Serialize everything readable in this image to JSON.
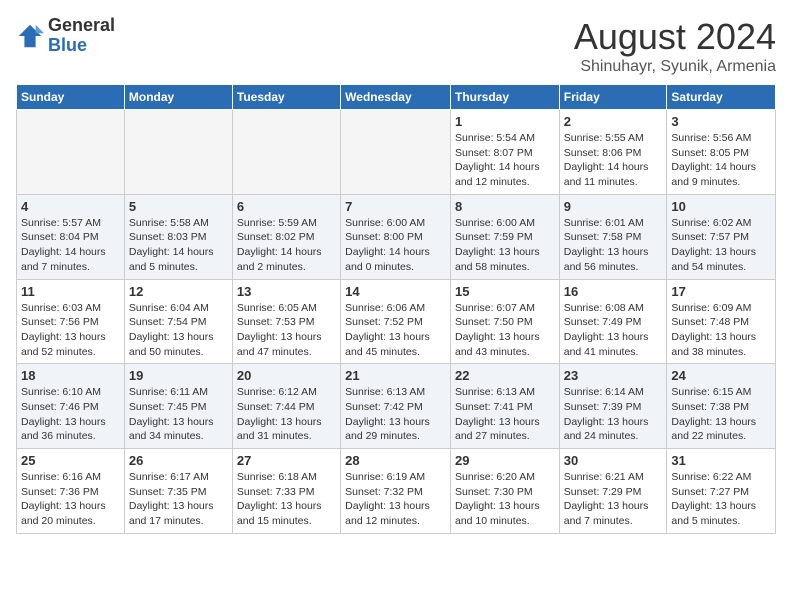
{
  "header": {
    "logo": {
      "general": "General",
      "blue": "Blue"
    },
    "title": "August 2024",
    "subtitle": "Shinuhayr, Syunik, Armenia"
  },
  "calendar": {
    "weekdays": [
      "Sunday",
      "Monday",
      "Tuesday",
      "Wednesday",
      "Thursday",
      "Friday",
      "Saturday"
    ],
    "weeks": [
      [
        {
          "day": "",
          "empty": true
        },
        {
          "day": "",
          "empty": true
        },
        {
          "day": "",
          "empty": true
        },
        {
          "day": "",
          "empty": true
        },
        {
          "day": "1",
          "sunrise": "5:54 AM",
          "sunset": "8:07 PM",
          "daylight": "14 hours and 12 minutes."
        },
        {
          "day": "2",
          "sunrise": "5:55 AM",
          "sunset": "8:06 PM",
          "daylight": "14 hours and 11 minutes."
        },
        {
          "day": "3",
          "sunrise": "5:56 AM",
          "sunset": "8:05 PM",
          "daylight": "14 hours and 9 minutes."
        }
      ],
      [
        {
          "day": "4",
          "sunrise": "5:57 AM",
          "sunset": "8:04 PM",
          "daylight": "14 hours and 7 minutes."
        },
        {
          "day": "5",
          "sunrise": "5:58 AM",
          "sunset": "8:03 PM",
          "daylight": "14 hours and 5 minutes."
        },
        {
          "day": "6",
          "sunrise": "5:59 AM",
          "sunset": "8:02 PM",
          "daylight": "14 hours and 2 minutes."
        },
        {
          "day": "7",
          "sunrise": "6:00 AM",
          "sunset": "8:00 PM",
          "daylight": "14 hours and 0 minutes."
        },
        {
          "day": "8",
          "sunrise": "6:00 AM",
          "sunset": "7:59 PM",
          "daylight": "13 hours and 58 minutes."
        },
        {
          "day": "9",
          "sunrise": "6:01 AM",
          "sunset": "7:58 PM",
          "daylight": "13 hours and 56 minutes."
        },
        {
          "day": "10",
          "sunrise": "6:02 AM",
          "sunset": "7:57 PM",
          "daylight": "13 hours and 54 minutes."
        }
      ],
      [
        {
          "day": "11",
          "sunrise": "6:03 AM",
          "sunset": "7:56 PM",
          "daylight": "13 hours and 52 minutes."
        },
        {
          "day": "12",
          "sunrise": "6:04 AM",
          "sunset": "7:54 PM",
          "daylight": "13 hours and 50 minutes."
        },
        {
          "day": "13",
          "sunrise": "6:05 AM",
          "sunset": "7:53 PM",
          "daylight": "13 hours and 47 minutes."
        },
        {
          "day": "14",
          "sunrise": "6:06 AM",
          "sunset": "7:52 PM",
          "daylight": "13 hours and 45 minutes."
        },
        {
          "day": "15",
          "sunrise": "6:07 AM",
          "sunset": "7:50 PM",
          "daylight": "13 hours and 43 minutes."
        },
        {
          "day": "16",
          "sunrise": "6:08 AM",
          "sunset": "7:49 PM",
          "daylight": "13 hours and 41 minutes."
        },
        {
          "day": "17",
          "sunrise": "6:09 AM",
          "sunset": "7:48 PM",
          "daylight": "13 hours and 38 minutes."
        }
      ],
      [
        {
          "day": "18",
          "sunrise": "6:10 AM",
          "sunset": "7:46 PM",
          "daylight": "13 hours and 36 minutes."
        },
        {
          "day": "19",
          "sunrise": "6:11 AM",
          "sunset": "7:45 PM",
          "daylight": "13 hours and 34 minutes."
        },
        {
          "day": "20",
          "sunrise": "6:12 AM",
          "sunset": "7:44 PM",
          "daylight": "13 hours and 31 minutes."
        },
        {
          "day": "21",
          "sunrise": "6:13 AM",
          "sunset": "7:42 PM",
          "daylight": "13 hours and 29 minutes."
        },
        {
          "day": "22",
          "sunrise": "6:13 AM",
          "sunset": "7:41 PM",
          "daylight": "13 hours and 27 minutes."
        },
        {
          "day": "23",
          "sunrise": "6:14 AM",
          "sunset": "7:39 PM",
          "daylight": "13 hours and 24 minutes."
        },
        {
          "day": "24",
          "sunrise": "6:15 AM",
          "sunset": "7:38 PM",
          "daylight": "13 hours and 22 minutes."
        }
      ],
      [
        {
          "day": "25",
          "sunrise": "6:16 AM",
          "sunset": "7:36 PM",
          "daylight": "13 hours and 20 minutes."
        },
        {
          "day": "26",
          "sunrise": "6:17 AM",
          "sunset": "7:35 PM",
          "daylight": "13 hours and 17 minutes."
        },
        {
          "day": "27",
          "sunrise": "6:18 AM",
          "sunset": "7:33 PM",
          "daylight": "13 hours and 15 minutes."
        },
        {
          "day": "28",
          "sunrise": "6:19 AM",
          "sunset": "7:32 PM",
          "daylight": "13 hours and 12 minutes."
        },
        {
          "day": "29",
          "sunrise": "6:20 AM",
          "sunset": "7:30 PM",
          "daylight": "13 hours and 10 minutes."
        },
        {
          "day": "30",
          "sunrise": "6:21 AM",
          "sunset": "7:29 PM",
          "daylight": "13 hours and 7 minutes."
        },
        {
          "day": "31",
          "sunrise": "6:22 AM",
          "sunset": "7:27 PM",
          "daylight": "13 hours and 5 minutes."
        }
      ]
    ]
  }
}
